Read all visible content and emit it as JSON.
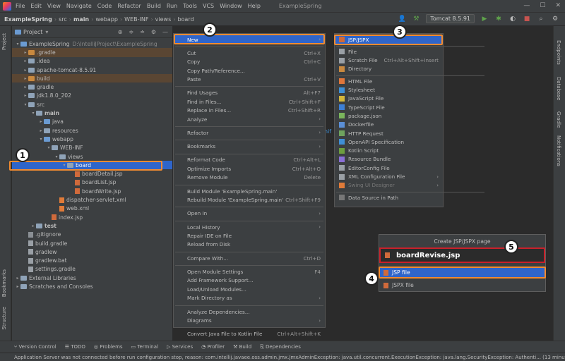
{
  "menubar": {
    "items": [
      "File",
      "Edit",
      "View",
      "Navigate",
      "Code",
      "Refactor",
      "Build",
      "Run",
      "Tools",
      "VCS",
      "Window",
      "Help"
    ],
    "app_title": "ExampleSpring"
  },
  "breadcrumbs": [
    "ExampleSpring",
    "src",
    "main",
    "webapp",
    "WEB-INF",
    "views",
    "board"
  ],
  "toolbar": {
    "run_config": "Tomcat 8.5.91"
  },
  "project_panel": {
    "title": "Project",
    "rows": [
      {
        "label": "ExampleSpring",
        "path": "D:\\IntelliJProject\\ExampleSpring",
        "depth": 0,
        "type": "folder-blue",
        "open": true
      },
      {
        "label": ".gradle",
        "depth": 1,
        "type": "folder-orange",
        "excluded": true
      },
      {
        "label": ".idea",
        "depth": 1,
        "type": "folder"
      },
      {
        "label": "apache-tomcat-8.5.91",
        "depth": 1,
        "type": "folder"
      },
      {
        "label": "build",
        "depth": 1,
        "type": "folder-orange",
        "excluded": true
      },
      {
        "label": "gradle",
        "depth": 1,
        "type": "folder"
      },
      {
        "label": "jdk1.8.0_202",
        "depth": 1,
        "type": "folder"
      },
      {
        "label": "src",
        "depth": 1,
        "type": "folder",
        "open": true
      },
      {
        "label": "main",
        "depth": 2,
        "type": "folder",
        "open": true,
        "bold": true
      },
      {
        "label": "java",
        "depth": 3,
        "type": "folder-blue"
      },
      {
        "label": "resources",
        "depth": 3,
        "type": "folder"
      },
      {
        "label": "webapp",
        "depth": 3,
        "type": "folder-blue",
        "open": true
      },
      {
        "label": "WEB-INF",
        "depth": 4,
        "type": "folder",
        "open": true
      },
      {
        "label": "views",
        "depth": 5,
        "type": "folder",
        "open": true
      },
      {
        "label": "board",
        "depth": 6,
        "type": "folder",
        "open": true,
        "selected": true
      },
      {
        "label": "boardDetail.jsp",
        "depth": 7,
        "type": "jsp"
      },
      {
        "label": "boardList.jsp",
        "depth": 7,
        "type": "jsp"
      },
      {
        "label": "boardWrite.jsp",
        "depth": 7,
        "type": "jsp"
      },
      {
        "label": "dispatcher-servlet.xml",
        "depth": 5,
        "type": "xml"
      },
      {
        "label": "web.xml",
        "depth": 5,
        "type": "xml"
      },
      {
        "label": "index.jsp",
        "depth": 4,
        "type": "jsp"
      },
      {
        "label": "test",
        "depth": 2,
        "type": "folder",
        "bold": true
      },
      {
        "label": ".gitignore",
        "depth": 1,
        "type": "git"
      },
      {
        "label": "build.gradle",
        "depth": 1,
        "type": "plain"
      },
      {
        "label": "gradlew",
        "depth": 1,
        "type": "plain"
      },
      {
        "label": "gradlew.bat",
        "depth": 1,
        "type": "plain"
      },
      {
        "label": "settings.gradle",
        "depth": 1,
        "type": "plain"
      },
      {
        "label": "External Libraries",
        "depth": 0,
        "type": "folder"
      },
      {
        "label": "Scratches and Consoles",
        "depth": 0,
        "type": "folder"
      }
    ]
  },
  "context_menu": {
    "items": [
      {
        "label": "New",
        "submenu": true,
        "highlight": true
      },
      {
        "sep": true
      },
      {
        "label": "Cut",
        "shortcut": "Ctrl+X"
      },
      {
        "label": "Copy",
        "shortcut": "Ctrl+C"
      },
      {
        "label": "Copy Path/Reference..."
      },
      {
        "label": "Paste",
        "shortcut": "Ctrl+V"
      },
      {
        "sep": true
      },
      {
        "label": "Find Usages",
        "shortcut": "Alt+F7"
      },
      {
        "label": "Find in Files...",
        "shortcut": "Ctrl+Shift+F"
      },
      {
        "label": "Replace in Files...",
        "shortcut": "Ctrl+Shift+R"
      },
      {
        "label": "Analyze",
        "submenu": true
      },
      {
        "sep": true
      },
      {
        "label": "Refactor",
        "submenu": true
      },
      {
        "sep": true
      },
      {
        "label": "Bookmarks",
        "submenu": true
      },
      {
        "sep": true
      },
      {
        "label": "Reformat Code",
        "shortcut": "Ctrl+Alt+L"
      },
      {
        "label": "Optimize Imports",
        "shortcut": "Ctrl+Alt+O"
      },
      {
        "label": "Remove Module",
        "shortcut": "Delete"
      },
      {
        "sep": true
      },
      {
        "label": "Build Module 'ExampleSpring.main'"
      },
      {
        "label": "Rebuild Module 'ExampleSpring.main'",
        "shortcut": "Ctrl+Shift+F9"
      },
      {
        "sep": true
      },
      {
        "label": "Open In",
        "submenu": true
      },
      {
        "sep": true
      },
      {
        "label": "Local History",
        "submenu": true
      },
      {
        "label": "Repair IDE on File"
      },
      {
        "label": "Reload from Disk"
      },
      {
        "sep": true
      },
      {
        "label": "Compare With...",
        "shortcut": "Ctrl+D"
      },
      {
        "sep": true
      },
      {
        "label": "Open Module Settings",
        "shortcut": "F4"
      },
      {
        "label": "Add Framework Support..."
      },
      {
        "label": "Load/Unload Modules..."
      },
      {
        "label": "Mark Directory as",
        "submenu": true
      },
      {
        "sep": true
      },
      {
        "label": "Analyze Dependencies..."
      },
      {
        "label": "Diagrams",
        "submenu": true
      },
      {
        "sep": true
      },
      {
        "label": "Convert Java File to Kotlin File",
        "shortcut": "Ctrl+Alt+Shift+K"
      }
    ]
  },
  "new_submenu": {
    "items": [
      {
        "label": "JSP/JSPX",
        "highlight": true
      },
      {
        "sep": true
      },
      {
        "label": "File"
      },
      {
        "label": "Scratch File",
        "shortcut": "Ctrl+Alt+Shift+Insert"
      },
      {
        "label": "Directory"
      },
      {
        "sep": true
      },
      {
        "label": "HTML File"
      },
      {
        "label": "Stylesheet"
      },
      {
        "label": "JavaScript File"
      },
      {
        "label": "TypeScript File"
      },
      {
        "label": "package.json"
      },
      {
        "label": "Dockerfile"
      },
      {
        "label": "HTTP Request"
      },
      {
        "label": "OpenAPI Specification"
      },
      {
        "label": "Kotlin Script"
      },
      {
        "label": "Resource Bundle"
      },
      {
        "label": "EditorConfig File"
      },
      {
        "label": "XML Configuration File",
        "submenu": true
      },
      {
        "label": "Swing UI Designer",
        "submenu": true,
        "disabled": true
      },
      {
        "sep": true
      },
      {
        "label": "Data Source in Path"
      }
    ]
  },
  "dialog": {
    "title": "Create JSP/JSPX page",
    "input_value": "boardRevise.jsp",
    "options": [
      {
        "label": "JSP file",
        "selected": true
      },
      {
        "label": "JSPX file"
      }
    ]
  },
  "editor_peek": "hif",
  "steps": [
    "1",
    "2",
    "3",
    "4",
    "5"
  ],
  "left_tabs": [
    "Project",
    "Bookmarks",
    "Structure"
  ],
  "right_tabs": [
    "Endpoints",
    "Database",
    "Gradle",
    "Notifications"
  ],
  "bottom_tabs": [
    "Version Control",
    "TODO",
    "Problems",
    "Terminal",
    "Services",
    "Profiler",
    "Build",
    "Dependencies"
  ],
  "status_text": "Application Server was not connected before run configuration stop, reason: com.intellij.javaee.oss.admin.jmx.JmxAdminException: java.util.concurrent.ExecutionException: java.lang.SecurityException: Authenti... (13 minutes"
}
